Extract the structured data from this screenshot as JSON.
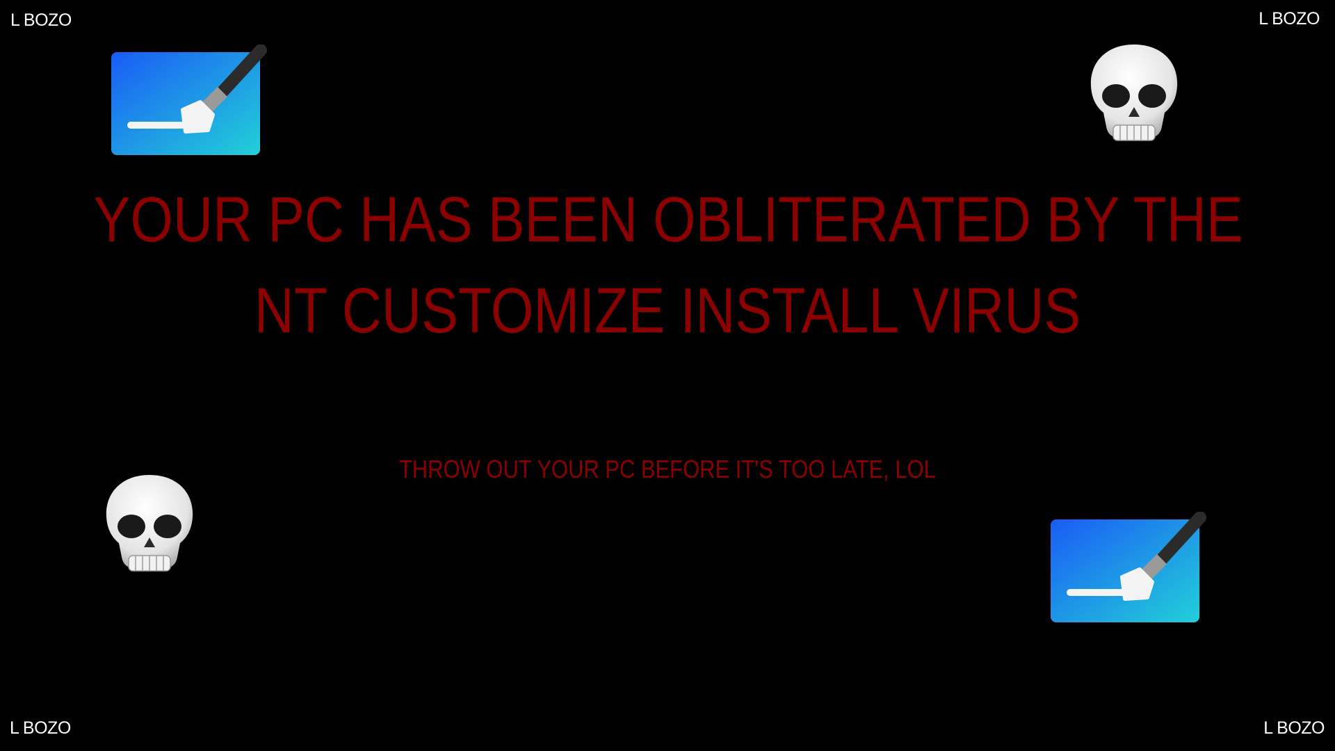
{
  "corners": {
    "top_left": "L BOZO",
    "top_right": "L BOZO",
    "bottom_left": "L BOZO",
    "bottom_right": "L BOZO"
  },
  "title": {
    "line1": "YOUR PC HAS BEEN OBLITERATED BY THE",
    "line2": "NT CUSTOMIZE INSTALL VIRUS"
  },
  "subtitle": "THROW OUT YOUR PC BEFORE IT'S TOO LATE, LOL",
  "icons": [
    "paint-app-icon",
    "skull-icon",
    "skull-icon",
    "paint-app-icon"
  ],
  "colors": {
    "background": "#000000",
    "text_red": "#8b0000",
    "corner_text": "#ffffff"
  }
}
